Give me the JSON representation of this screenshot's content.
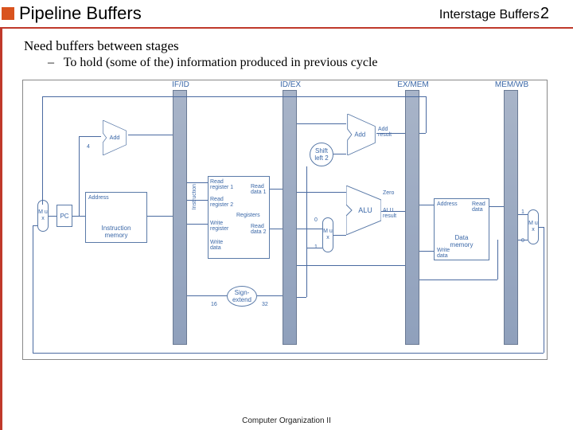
{
  "header": {
    "title": "Pipeline Buffers",
    "subtitle": "Interstage Buffers",
    "page": "2"
  },
  "body": {
    "p1": "Need buffers between stages",
    "p2": "To hold (some of the) information produced in previous cycle"
  },
  "footer": {
    "text": "Computer Organization II"
  },
  "regs": {
    "r1": "IF/ID",
    "r2": "ID/EX",
    "r3": "EX/MEM",
    "r4": "MEM/WB"
  },
  "blocks": {
    "add1": "Add",
    "pc": "PC",
    "imem": "Instruction\nmemory",
    "addr": "Address",
    "instr": "Instruction",
    "rf": "Registers",
    "rr1": "Read\nregister 1",
    "rr2": "Read\nregister 2",
    "wr": "Write\nregister",
    "wd": "Write\ndata",
    "rd1": "Read\ndata 1",
    "rd2": "Read\ndata 2",
    "se": "Sign-\nextend",
    "sl": "Shift\nleft 2",
    "add2": "Add",
    "addres": "Add\nresult",
    "alu": "ALU",
    "zero": "Zero",
    "alures": "ALU\nresult",
    "dmem": "Data\nmemory",
    "daddr": "Address",
    "dwd": "Write\ndata",
    "drd": "Read\ndata",
    "mux": "M\nu\nx",
    "four": "4",
    "n16": "16",
    "n32": "32",
    "zero0": "0",
    "one1": "1"
  },
  "chart_data": {
    "type": "diagram",
    "title": "MIPS 5-stage pipeline datapath with interstage pipeline registers",
    "stages": [
      "IF",
      "ID",
      "EX",
      "MEM",
      "WB"
    ],
    "pipeline_registers": [
      "IF/ID",
      "ID/EX",
      "EX/MEM",
      "MEM/WB"
    ],
    "components": {
      "IF": [
        "PC",
        "Instruction memory",
        "Add (PC+4)",
        "Mux (branch target select)"
      ],
      "ID": [
        "Registers (register file)",
        "Sign-extend 16→32"
      ],
      "EX": [
        "Shift left 2",
        "Add (branch target)",
        "ALU",
        "Mux (ALU src)"
      ],
      "MEM": [
        "Data memory"
      ],
      "WB": [
        "Mux (mem-to-reg)"
      ]
    },
    "constants": {
      "pc_increment": 4,
      "sign_extend_in_bits": 16,
      "sign_extend_out_bits": 32
    },
    "edges": [
      [
        "PC",
        "Instruction memory.Address"
      ],
      [
        "PC",
        "Add(PC+4).in0"
      ],
      [
        "4",
        "Add(PC+4).in1"
      ],
      [
        "Add(PC+4).out",
        "IF/ID"
      ],
      [
        "Add(PC+4).out",
        "Mux(nextPC).0"
      ],
      [
        "Instruction memory.Instruction",
        "IF/ID"
      ],
      [
        "IF/ID",
        "Registers.ReadReg1"
      ],
      [
        "IF/ID",
        "Registers.ReadReg2"
      ],
      [
        "IF/ID",
        "Registers.WriteReg"
      ],
      [
        "IF/ID",
        "Sign-extend.in"
      ],
      [
        "Registers.ReadData1",
        "ID/EX"
      ],
      [
        "Registers.ReadData2",
        "ID/EX"
      ],
      [
        "Sign-extend.out",
        "ID/EX"
      ],
      [
        "ID/EX",
        "ALU.in0"
      ],
      [
        "ID/EX",
        "Mux(ALUsrc).0"
      ],
      [
        "ID/EX(sign-ext)",
        "Mux(ALUsrc).1"
      ],
      [
        "ID/EX(sign-ext)",
        "Shift left 2"
      ],
      [
        "Shift left 2",
        "Add(branch).in1"
      ],
      [
        "ID/EX(PC+4)",
        "Add(branch).in0"
      ],
      [
        "Mux(ALUsrc).out",
        "ALU.in1"
      ],
      [
        "ALU.Zero",
        "EX/MEM"
      ],
      [
        "ALU.result",
        "EX/MEM"
      ],
      [
        "Add(branch).result",
        "EX/MEM"
      ],
      [
        "ID/EX.ReadData2",
        "EX/MEM"
      ],
      [
        "EX/MEM",
        "Data memory.Address"
      ],
      [
        "EX/MEM",
        "Data memory.WriteData"
      ],
      [
        "Data memory.ReadData",
        "MEM/WB"
      ],
      [
        "EX/MEM.ALUresult",
        "MEM/WB"
      ],
      [
        "MEM/WB",
        "Mux(MemToReg).0"
      ],
      [
        "MEM/WB",
        "Mux(MemToReg).1"
      ],
      [
        "Mux(MemToReg).out",
        "Registers.WriteData"
      ],
      [
        "EX/MEM.branchTarget",
        "Mux(nextPC).1"
      ],
      [
        "Mux(nextPC).out",
        "PC"
      ]
    ]
  }
}
